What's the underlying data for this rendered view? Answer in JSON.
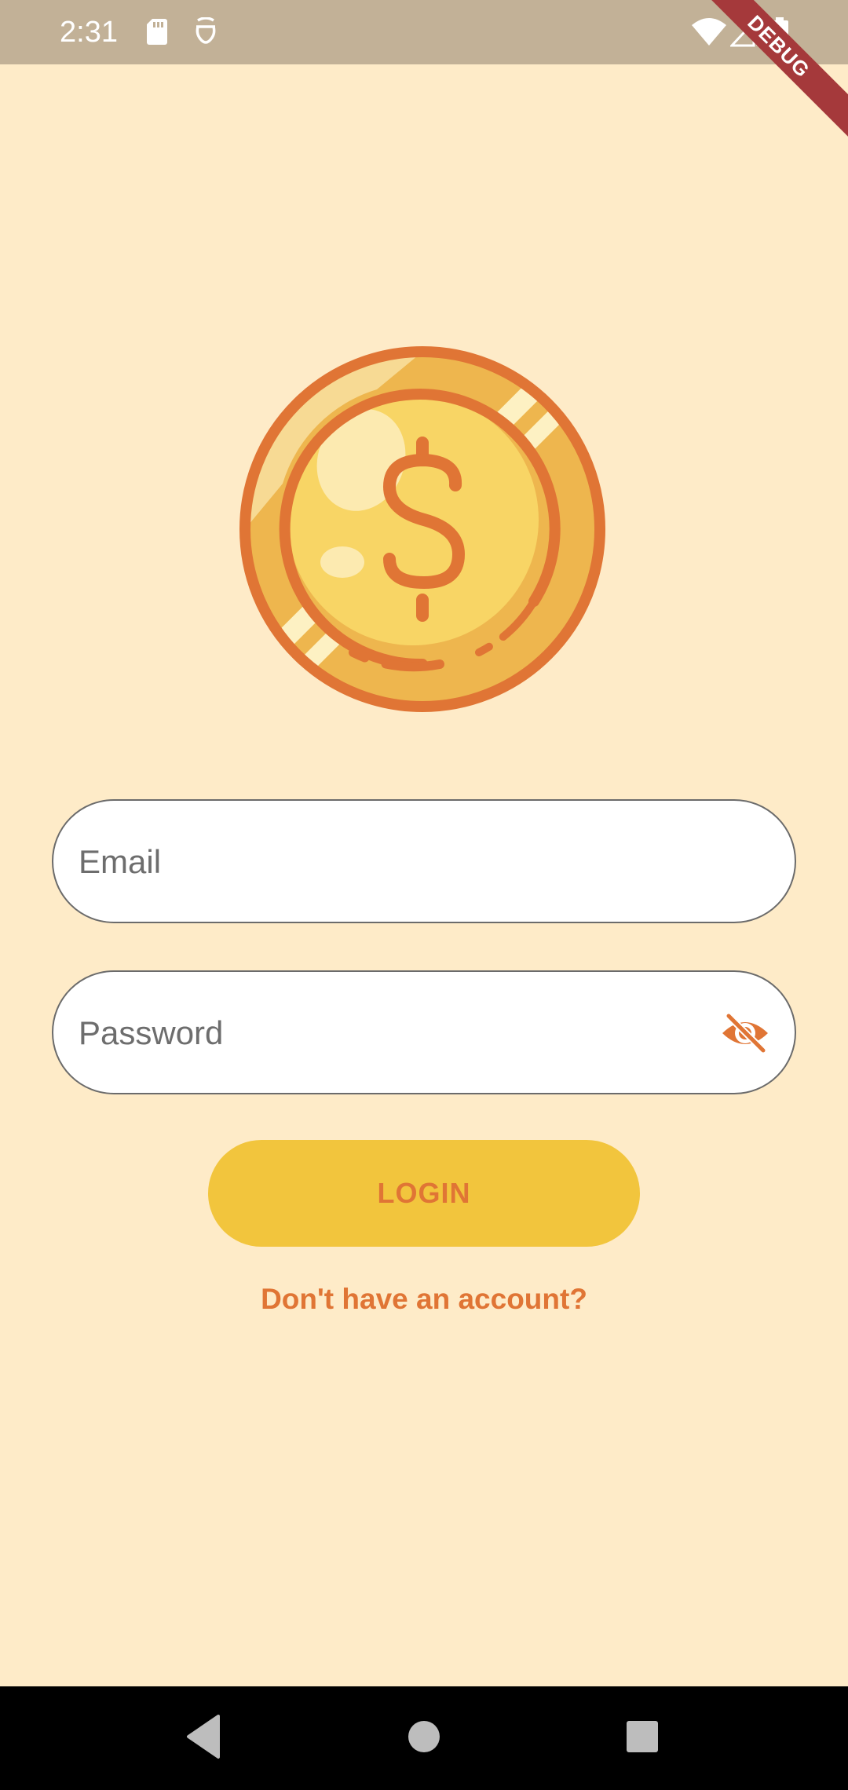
{
  "status_bar": {
    "time": "2:31",
    "icons": [
      "sd-card-icon",
      "sim-icon",
      "wifi-icon",
      "signal-icon",
      "battery-icon"
    ],
    "debug_banner": "DEBUG"
  },
  "logo": {
    "icon": "coin-dollar-icon"
  },
  "email_field": {
    "placeholder": "Email",
    "value": ""
  },
  "password_field": {
    "placeholder": "Password",
    "value": "",
    "toggle_icon": "eye-off-icon"
  },
  "login_button": {
    "label": "LOGIN"
  },
  "signup_link": {
    "label": "Don't have an account?"
  },
  "nav_bar": {
    "buttons": [
      "back-icon",
      "home-icon",
      "recents-icon"
    ]
  },
  "colors": {
    "background": "#FEEBC8",
    "status_bar": "#C2B197",
    "accent": "#E07535",
    "button": "#F2C53D"
  }
}
